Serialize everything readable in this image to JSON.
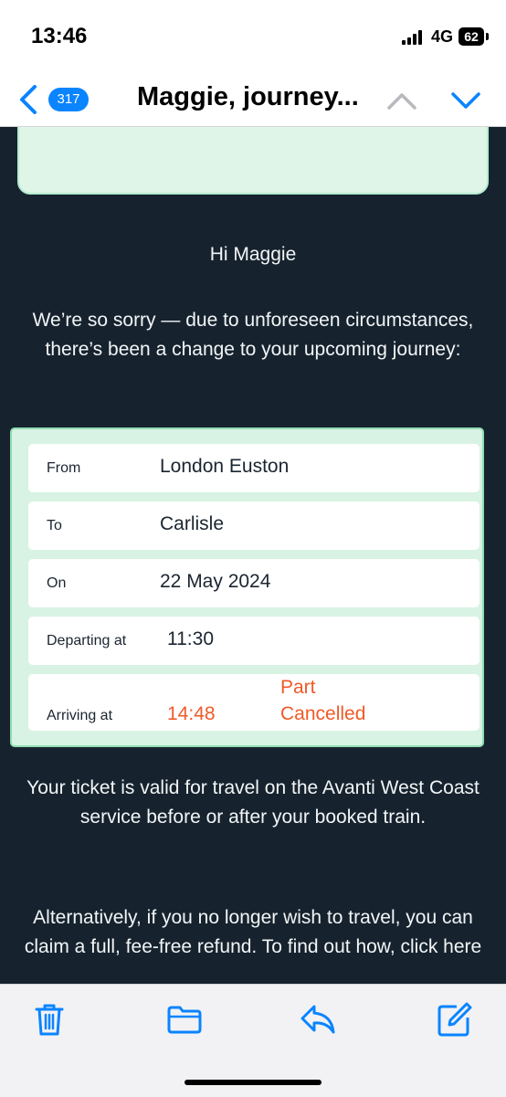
{
  "status_bar": {
    "time": "13:46",
    "network": "4G",
    "battery": "62"
  },
  "nav": {
    "unread_count": "317",
    "title": "Maggie, journey...",
    "icons": [
      "back-chevron-icon",
      "chevron-up-icon",
      "chevron-down-icon"
    ]
  },
  "email": {
    "greeting": "Hi Maggie",
    "intro": "We’re so sorry — due to unforeseen circumstances, there’s been a change to your upcoming journey:",
    "journey": {
      "from_label": "From",
      "from_value": "London Euston",
      "to_label": "To",
      "to_value": "Carlisle",
      "on_label": "On",
      "on_value": "22 May 2024",
      "departing_label": "Departing at",
      "departing_value": "11:30",
      "arriving_label": "Arriving at",
      "arriving_value": "14:48",
      "arriving_status_line1": "Part",
      "arriving_status_line2": "Cancelled"
    },
    "validity": "Your ticket is valid for travel on the Avanti West Coast service before or after your booked train.",
    "refund": "Alternatively, if you no longer wish to travel, you can claim a full, fee-free refund. To find out how, click here"
  },
  "toolbar": {
    "icons": [
      "trash-icon",
      "folder-icon",
      "reply-icon",
      "compose-icon"
    ]
  },
  "colors": {
    "accent": "#0a84ff",
    "email_bg": "#16232e",
    "panel_green": "#d8f3e3",
    "alert": "#f05a28"
  }
}
